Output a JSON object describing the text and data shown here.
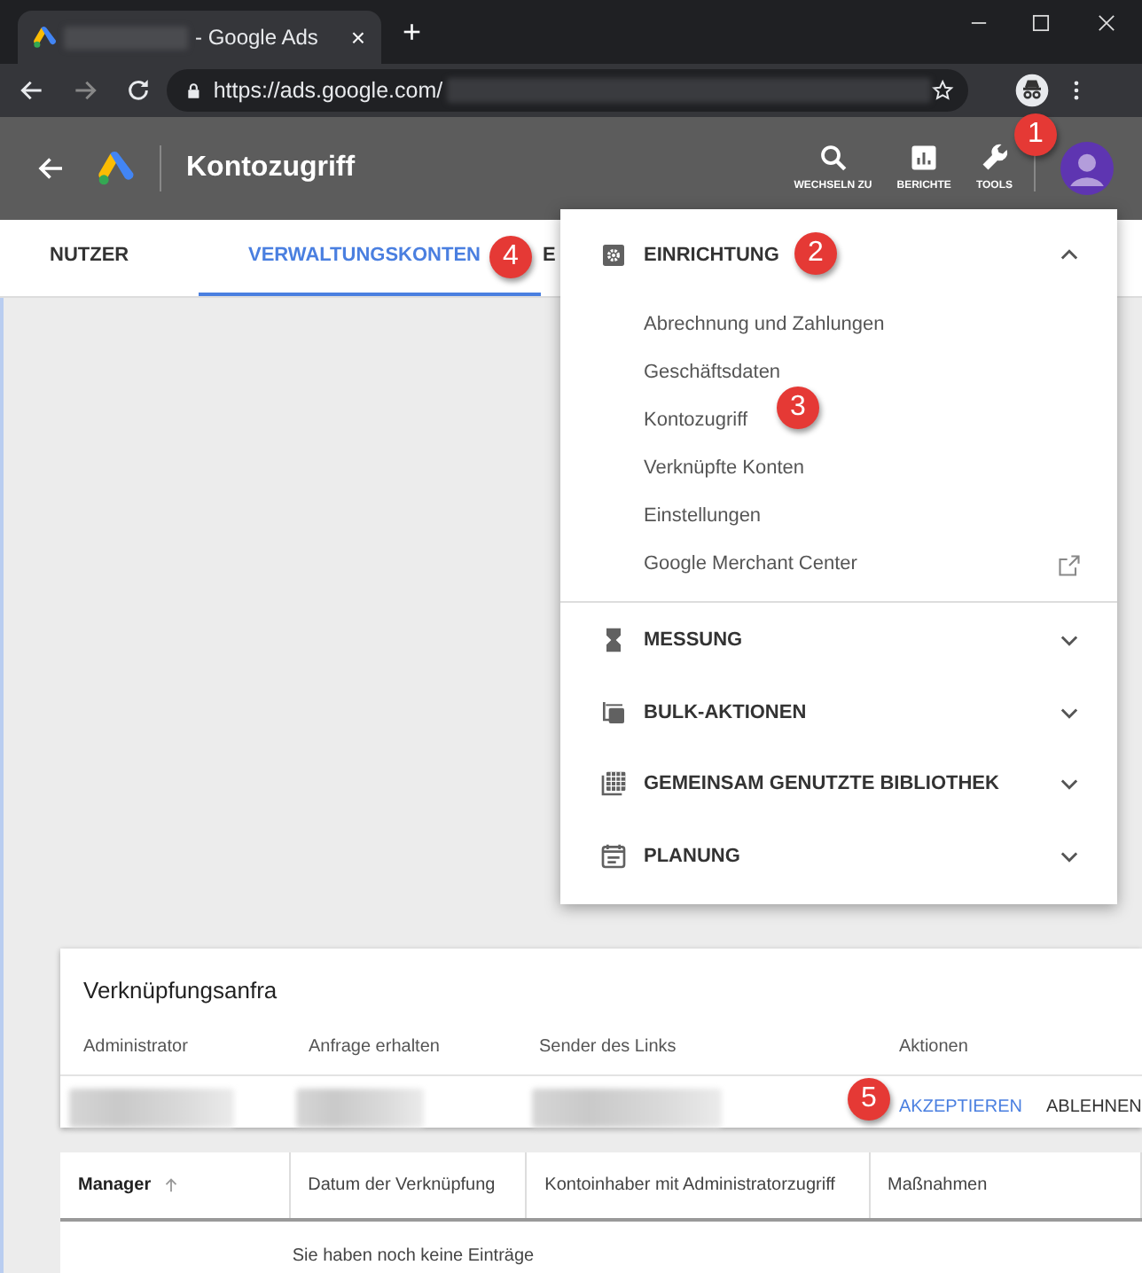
{
  "browser": {
    "tab_title": "- Google Ads",
    "tab_close": "×",
    "new_tab": "+",
    "url": "https://ads.google.com/"
  },
  "app_bar": {
    "title": "Kontozugriff",
    "actions": [
      {
        "label": "WECHSELN ZU"
      },
      {
        "label": "BERICHTE"
      },
      {
        "label": "TOOLS"
      }
    ]
  },
  "tabs": [
    {
      "label": "NUTZER",
      "selected": false
    },
    {
      "label": "VERWALTUNGSKONTEN",
      "selected": true
    },
    {
      "label": "E",
      "selected": false
    }
  ],
  "menu": {
    "sections": [
      {
        "title": "EINRICHTUNG",
        "expanded": true,
        "items": [
          {
            "label": "Abrechnung und Zahlungen",
            "external": false
          },
          {
            "label": "Geschäftsdaten",
            "external": false
          },
          {
            "label": "Kontozugriff",
            "external": false
          },
          {
            "label": "Verknüpfte Konten",
            "external": false
          },
          {
            "label": "Einstellungen",
            "external": false
          },
          {
            "label": "Google Merchant Center",
            "external": true
          }
        ]
      },
      {
        "title": "MESSUNG",
        "expanded": false
      },
      {
        "title": "BULK-AKTIONEN",
        "expanded": false
      },
      {
        "title": "GEMEINSAM GENUTZTE BIBLIOTHEK",
        "expanded": false
      },
      {
        "title": "PLANUNG",
        "expanded": false
      }
    ]
  },
  "requests_card": {
    "title": "Verknüpfungsanfra",
    "columns": [
      "Administrator",
      "Anfrage erhalten",
      "Sender des Links",
      "Aktionen"
    ],
    "actions": [
      {
        "label": "AKZEPTIEREN",
        "primary": true
      },
      {
        "label": "ABLEHNEN",
        "primary": false
      }
    ]
  },
  "managers_table": {
    "columns": [
      {
        "label": "Manager",
        "sorted": true
      },
      {
        "label": "Datum der Verknüpfung",
        "sorted": false
      },
      {
        "label": "Kontoinhaber mit Administratorzugriff",
        "sorted": false
      },
      {
        "label": "Maßnahmen",
        "sorted": false
      }
    ],
    "empty_message": "Sie haben noch keine Einträge"
  },
  "callouts": [
    "1",
    "2",
    "3",
    "4",
    "5"
  ]
}
